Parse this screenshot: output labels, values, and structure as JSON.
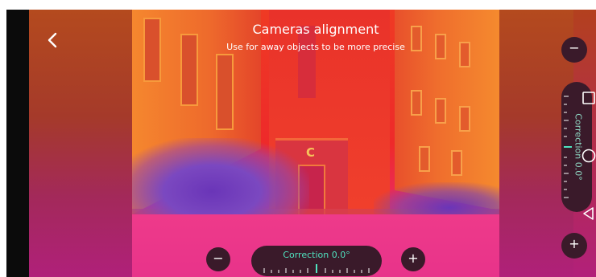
{
  "header": {
    "title": "Cameras alignment",
    "subtitle": "Use for away objects to be more precise"
  },
  "bottom_control": {
    "minus_label": "−",
    "plus_label": "+",
    "correction_label": "Correction  0.0°"
  },
  "side_control": {
    "minus_label": "−",
    "plus_label": "+",
    "correction_label": "Correction  0.0°"
  },
  "colors": {
    "accent": "#4fe3c0",
    "control_bg": "#3a1a2a"
  },
  "icons": {
    "back": "chevron-left-icon",
    "recents": "square-icon",
    "home": "circle-icon",
    "nav_back": "triangle-back-icon"
  }
}
